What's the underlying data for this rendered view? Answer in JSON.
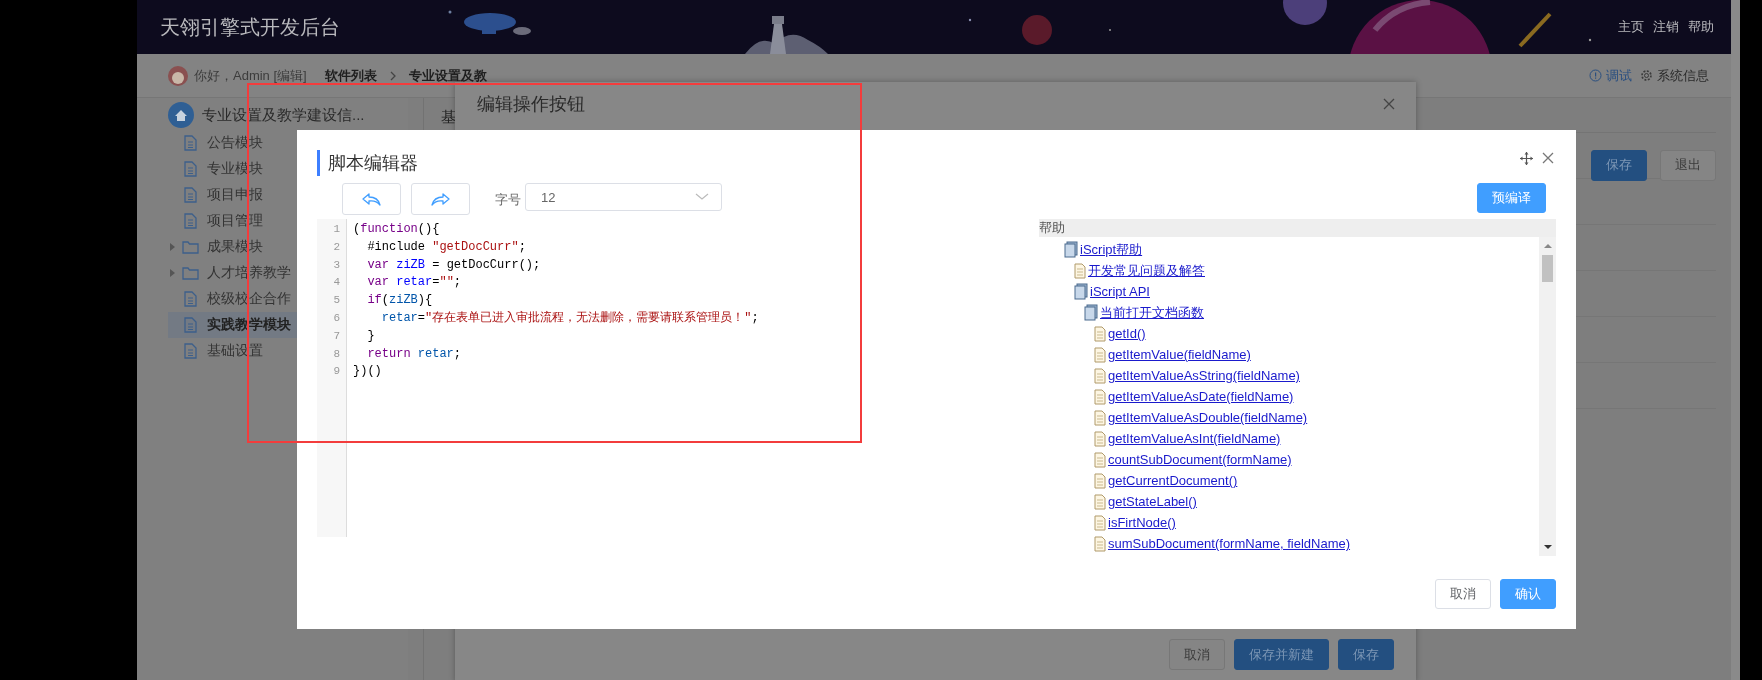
{
  "header": {
    "title": "天翎引擎式开发后台",
    "links": [
      "主页",
      "注销",
      "帮助"
    ]
  },
  "breadcrumb": {
    "greeting": "你好，Admin [编辑]",
    "items": [
      "软件列表",
      "专业设置及教"
    ],
    "tools": [
      {
        "kind": "debug",
        "label": "调试"
      },
      {
        "kind": "settings",
        "label": "系统信息"
      }
    ]
  },
  "sidebar": {
    "title": "专业设置及教学建设信...",
    "items": [
      {
        "label": "公告模块",
        "kind": "page",
        "selected": false
      },
      {
        "label": "专业模块",
        "kind": "page",
        "selected": false
      },
      {
        "label": "项目申报",
        "kind": "page",
        "selected": false
      },
      {
        "label": "项目管理",
        "kind": "page",
        "selected": false
      },
      {
        "label": "成果模块",
        "kind": "folder",
        "expanded": false,
        "selected": false
      },
      {
        "label": "人才培养教学",
        "kind": "folder",
        "expanded": false,
        "selected": false
      },
      {
        "label": "校级校企合作",
        "kind": "page",
        "selected": false
      },
      {
        "label": "实践教学模块",
        "kind": "page",
        "selected": true
      },
      {
        "label": "基础设置",
        "kind": "page",
        "selected": false
      }
    ]
  },
  "content": {
    "title": "基",
    "buttons": [
      {
        "label": "保存",
        "kind": "primary"
      },
      {
        "label": "退出",
        "kind": "default"
      }
    ]
  },
  "back_dialog": {
    "title": "编辑操作按钮",
    "buttons": [
      {
        "label": "取消",
        "kind": "default"
      },
      {
        "label": "保存并新建",
        "kind": "primary"
      },
      {
        "label": "保存",
        "kind": "primary"
      }
    ]
  },
  "script_editor": {
    "title": "脚本编辑器",
    "font_size_label": "字号",
    "font_size": "12",
    "precompile_button": "预编译",
    "code_lines": [
      {
        "number": "1",
        "tokens": [
          {
            "text": "(",
            "kind": "plain"
          },
          {
            "text": "function",
            "kind": "keyword"
          },
          {
            "text": "(){",
            "kind": "plain"
          }
        ]
      },
      {
        "number": "2",
        "tokens": [
          {
            "text": "  #include ",
            "kind": "plain"
          },
          {
            "text": "\"getDocCurr\"",
            "kind": "string"
          },
          {
            "text": ";",
            "kind": "plain"
          }
        ]
      },
      {
        "number": "3",
        "tokens": [
          {
            "text": "  var ",
            "kind": "keyword"
          },
          {
            "text": "ziZB",
            "kind": "def"
          },
          {
            "text": " = getDocCurr();",
            "kind": "plain"
          }
        ]
      },
      {
        "number": "4",
        "tokens": [
          {
            "text": "  var ",
            "kind": "keyword"
          },
          {
            "text": "retar",
            "kind": "def"
          },
          {
            "text": "=",
            "kind": "plain"
          },
          {
            "text": "\"\"",
            "kind": "string"
          },
          {
            "text": ";",
            "kind": "plain"
          }
        ]
      },
      {
        "number": "5",
        "tokens": [
          {
            "text": "  if",
            "kind": "keyword"
          },
          {
            "text": "(",
            "kind": "plain"
          },
          {
            "text": "ziZB",
            "kind": "variable"
          },
          {
            "text": "){",
            "kind": "plain"
          }
        ]
      },
      {
        "number": "6",
        "tokens": [
          {
            "text": "    retar",
            "kind": "variable"
          },
          {
            "text": "=",
            "kind": "plain"
          },
          {
            "text": "\"存在表单已进入审批流程，无法删除，需要请联系管理员！\"",
            "kind": "string"
          },
          {
            "text": ";",
            "kind": "plain"
          }
        ]
      },
      {
        "number": "7",
        "tokens": [
          {
            "text": "  }",
            "kind": "plain"
          }
        ]
      },
      {
        "number": "8",
        "tokens": [
          {
            "text": "  return ",
            "kind": "keyword"
          },
          {
            "text": "retar",
            "kind": "variable"
          },
          {
            "text": ";",
            "kind": "plain"
          }
        ]
      },
      {
        "number": "9",
        "tokens": [
          {
            "text": "})()",
            "kind": "plain"
          }
        ]
      }
    ],
    "help": {
      "title": "帮助",
      "tree": [
        {
          "label": "iScript帮助",
          "children": [
            {
              "label": "开发常见问题及解答"
            },
            {
              "label": "iScript API",
              "children": [
                {
                  "label": "当前打开文档函数",
                  "children": [
                    {
                      "label": "getId()"
                    },
                    {
                      "label": "getItemValue(fieldName)"
                    },
                    {
                      "label": "getItemValueAsString(fieldName)"
                    },
                    {
                      "label": "getItemValueAsDate(fieldName)"
                    },
                    {
                      "label": "getItemValueAsDouble(fieldName)"
                    },
                    {
                      "label": "getItemValueAsInt(fieldName)"
                    },
                    {
                      "label": "countSubDocument(formName)"
                    },
                    {
                      "label": "getCurrentDocument()"
                    },
                    {
                      "label": "getStateLabel()"
                    },
                    {
                      "label": "isFirtNode()"
                    },
                    {
                      "label": "sumSubDocument(formName, fieldName)"
                    }
                  ]
                }
              ]
            }
          ]
        }
      ]
    },
    "buttons": [
      {
        "label": "取消",
        "kind": "default"
      },
      {
        "label": "确认",
        "kind": "primary"
      }
    ]
  }
}
